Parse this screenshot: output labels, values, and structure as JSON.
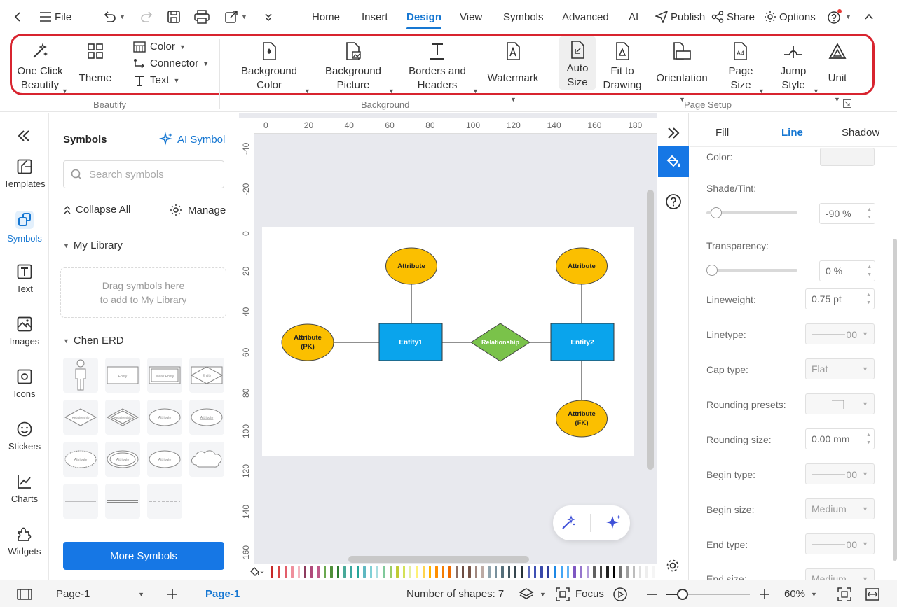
{
  "topbar": {
    "file_label": "File",
    "menus": [
      {
        "label": "Home",
        "active": false
      },
      {
        "label": "Insert",
        "active": false
      },
      {
        "label": "Design",
        "active": true
      },
      {
        "label": "View",
        "active": false
      },
      {
        "label": "Symbols",
        "active": false
      },
      {
        "label": "Advanced",
        "active": false
      },
      {
        "label": "AI",
        "active": false
      }
    ],
    "publish_label": "Publish",
    "share_label": "Share",
    "options_label": "Options"
  },
  "ribbon": {
    "beautify": {
      "one_click_line1": "One Click",
      "one_click_line2": "Beautify",
      "theme": "Theme",
      "color": "Color",
      "connector": "Connector",
      "text": "Text",
      "group_label": "Beautify"
    },
    "background": {
      "bg_color_line1": "Background",
      "bg_color_line2": "Color",
      "bg_picture_line1": "Background",
      "bg_picture_line2": "Picture",
      "borders_line1": "Borders and",
      "borders_line2": "Headers",
      "watermark": "Watermark",
      "group_label": "Background"
    },
    "page_setup": {
      "auto_size_line1": "Auto",
      "auto_size_line2": "Size",
      "fit_line1": "Fit to",
      "fit_line2": "Drawing",
      "orientation": "Orientation",
      "page_size_line1": "Page",
      "page_size_line2": "Size",
      "jump_line1": "Jump",
      "jump_line2": "Style",
      "unit": "Unit",
      "group_label": "Page Setup"
    },
    "highlight_color": "#d8242f"
  },
  "rail": {
    "items": [
      {
        "label": "Templates",
        "icon": "templates-icon",
        "active": false
      },
      {
        "label": "Symbols",
        "icon": "symbols-icon",
        "active": true
      },
      {
        "label": "Text",
        "icon": "text-icon",
        "active": false
      },
      {
        "label": "Images",
        "icon": "images-icon",
        "active": false
      },
      {
        "label": "Icons",
        "icon": "icons-icon",
        "active": false
      },
      {
        "label": "Stickers",
        "icon": "stickers-icon",
        "active": false
      },
      {
        "label": "Charts",
        "icon": "charts-icon",
        "active": false
      },
      {
        "label": "Widgets",
        "icon": "widgets-icon",
        "active": false
      }
    ]
  },
  "symbols": {
    "title": "Symbols",
    "ai_symbol": "AI Symbol",
    "search_placeholder": "Search symbols",
    "collapse_all": "Collapse All",
    "manage": "Manage",
    "my_library": "My Library",
    "drop_line1": "Drag symbols here",
    "drop_line2": "to add to My Library",
    "chen_erd": "Chen ERD",
    "more_symbols": "More Symbols"
  },
  "canvas": {
    "h_ticks": [
      "0",
      "20",
      "40",
      "60",
      "80",
      "100",
      "120",
      "140",
      "160",
      "180"
    ],
    "v_ticks": [
      "-40",
      "-20",
      "0",
      "20",
      "40",
      "60",
      "80",
      "100",
      "120",
      "140",
      "160"
    ],
    "diagram": {
      "attr_top_left": "Attribute",
      "attr_top_right": "Attribute",
      "attr_pk_line1": "Attribute",
      "attr_pk_line2": "(PK)",
      "attr_fk_line1": "Attribute",
      "attr_fk_line2": "(FK)",
      "entity1": "Entity1",
      "entity2": "Entity2",
      "relationship": "Relationship"
    },
    "colors": {
      "attribute": "#fbbf00",
      "entity": "#0aa4ec",
      "relationship": "#7ac24a"
    },
    "palette": [
      "#c62828",
      "#d84343",
      "#e35d6a",
      "#ef8f9c",
      "#f4b6bf",
      "#8e3b5e",
      "#b0497a",
      "#c05a8a",
      "#6aa84f",
      "#4f8f3a",
      "#2e7d32",
      "#48a999",
      "#3aa7a0",
      "#26a69a",
      "#5fb8c1",
      "#7fd0d6",
      "#a8dde0",
      "#80c99b",
      "#9ccc65",
      "#c0ca33",
      "#d4e157",
      "#e6ee9c",
      "#fff176",
      "#ffd54f",
      "#ffb300",
      "#ff8f00",
      "#f57c00",
      "#ef6c00",
      "#8d6e63",
      "#6d4c41",
      "#795548",
      "#a1887f",
      "#bcaaa4",
      "#90a4ae",
      "#78909c",
      "#546e7a",
      "#455a64",
      "#37474f",
      "#263238",
      "#5c6bc0",
      "#3f51b5",
      "#3949ab",
      "#303f9f",
      "#1e88e5",
      "#42a5f5",
      "#64b5f6",
      "#7e57c2",
      "#9575cd",
      "#b39ddb",
      "#616161",
      "#424242",
      "#212121",
      "#000000",
      "#757575",
      "#9e9e9e",
      "#bdbdbd",
      "#e0e0e0",
      "#eeeeee",
      "#f5f5f5"
    ]
  },
  "props": {
    "tabs": [
      {
        "label": "Fill",
        "active": false
      },
      {
        "label": "Line",
        "active": true
      },
      {
        "label": "Shadow",
        "active": false
      }
    ],
    "color_label": "Color:",
    "shade_label": "Shade/Tint:",
    "shade_value": "-90 %",
    "shade_level": 0.05,
    "transparency_label": "Transparency:",
    "transparency_value": "0 %",
    "transparency_level": 0,
    "lineweight_label": "Lineweight:",
    "lineweight_value": "0.75 pt",
    "linetype_label": "Linetype:",
    "linetype_value": "00",
    "cap_label": "Cap type:",
    "cap_value": "Flat",
    "rounding_presets_label": "Rounding presets:",
    "rounding_size_label": "Rounding size:",
    "rounding_size_value": "0.00 mm",
    "begin_type_label": "Begin type:",
    "begin_type_value": "00",
    "begin_size_label": "Begin size:",
    "begin_size_value": "Medium",
    "end_type_label": "End type:",
    "end_type_value": "00",
    "end_size_label": "End size:",
    "end_size_value": "Medium"
  },
  "status": {
    "page_select": "Page-1",
    "page_tab": "Page-1",
    "shape_count": "Number of shapes: 7",
    "focus": "Focus",
    "zoom": "60%",
    "zoom_level": 0.2
  }
}
